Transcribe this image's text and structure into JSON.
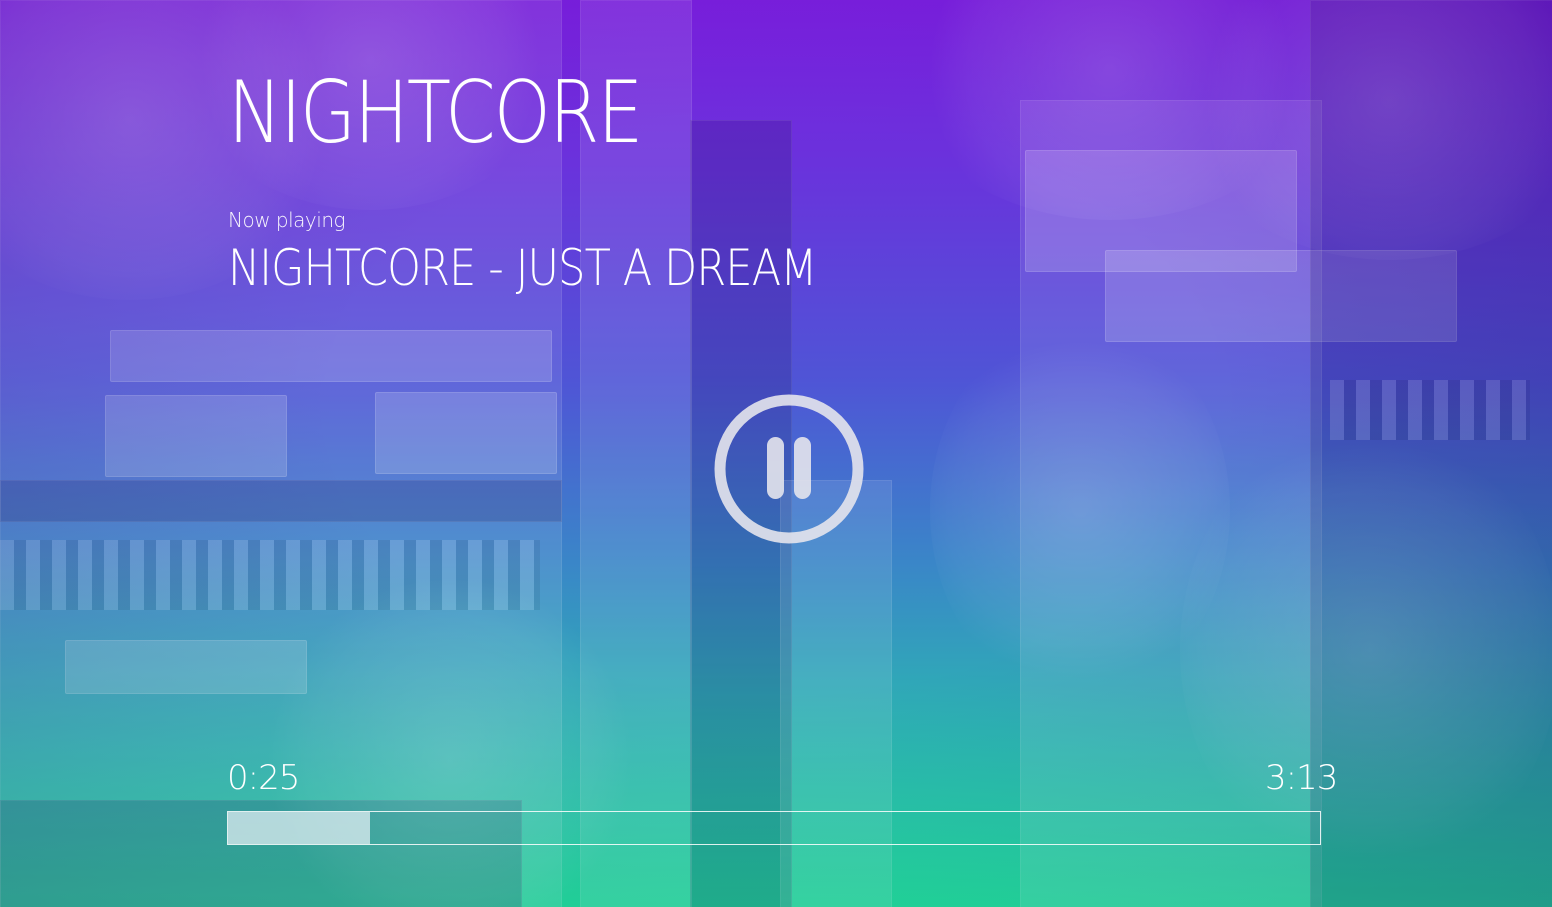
{
  "app": {
    "title": "NIGHTCORE"
  },
  "now_playing": {
    "label": "Now playing",
    "track_title": "NIGHTCORE - JUST A DREAM"
  },
  "controls": {
    "play_state": "playing",
    "toggle_icon": "pause-icon"
  },
  "progress": {
    "current_time": "0:25",
    "total_time": "3:13",
    "fraction": 0.13
  },
  "colors": {
    "gradient_top": "#7c1fe0",
    "gradient_bottom": "#20e49a",
    "text": "#ffffff",
    "progress_fill": "#e6f0f5"
  }
}
